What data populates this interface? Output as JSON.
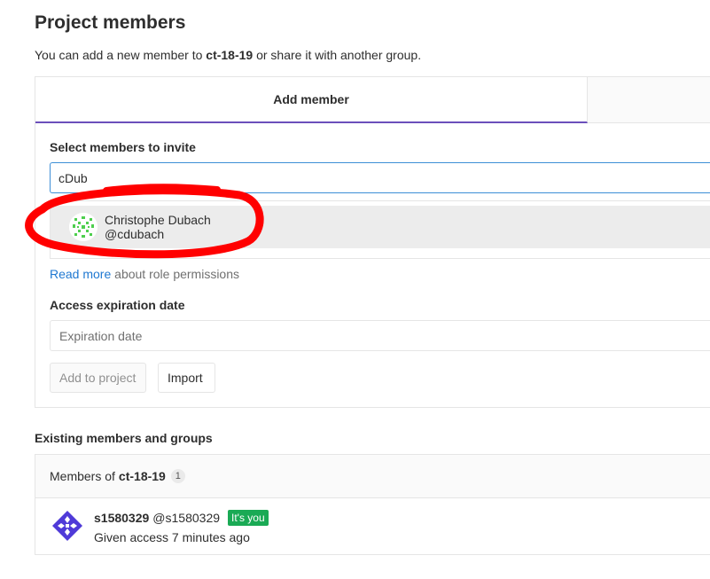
{
  "header": {
    "title": "Project members",
    "subtitle_prefix": "You can add a new member to ",
    "project_name": "ct-18-19",
    "subtitle_suffix": " or share it with another group."
  },
  "tabs": {
    "add_member": "Add member"
  },
  "invite": {
    "select_label": "Select members to invite",
    "search_value": "cDub",
    "suggestion": {
      "name": "Christophe Dubach",
      "username": "@cdubach"
    },
    "read_more_link": "Read more",
    "read_more_suffix": " about role permissions",
    "expiration_label": "Access expiration date",
    "expiration_placeholder": "Expiration date",
    "add_button": "Add to project",
    "import_button": "Import"
  },
  "existing": {
    "title": "Existing members and groups",
    "header_prefix": "Members of",
    "project_name": "ct-18-19",
    "count": "1",
    "members": [
      {
        "name": "s1580329",
        "handle": "@s1580329",
        "badge": "It's you",
        "access": "Given access 7 minutes ago"
      }
    ]
  },
  "colors": {
    "accent_tab": "#6b4fbb",
    "link": "#1f78d1",
    "input_focus": "#3d8fd6",
    "you_badge": "#1aaa55",
    "annotation": "#ff0000"
  },
  "icons": {
    "suggestion_avatar": "identicon-green",
    "member_avatar": "identicon-purple"
  }
}
